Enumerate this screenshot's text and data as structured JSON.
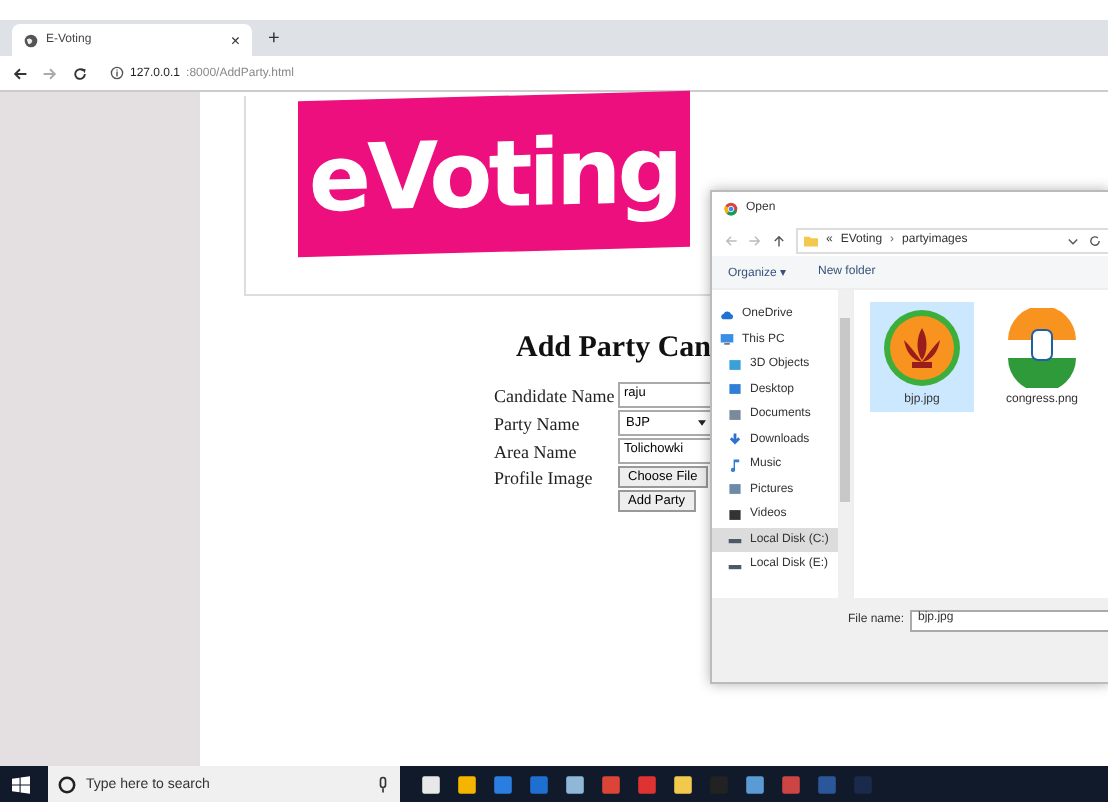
{
  "browser": {
    "tab": {
      "title": "E-Voting",
      "close": "×"
    },
    "new_tab": "+",
    "address": {
      "host": "127.0.0.1",
      "path": ":8000/AddParty.html"
    }
  },
  "page": {
    "logo": "eVoting",
    "heading": "Add Party Can",
    "fields": [
      {
        "label": "Candidate Name",
        "kind": "text",
        "value": "raju"
      },
      {
        "label": "Party Name",
        "kind": "select",
        "value": "BJP"
      },
      {
        "label": "Area Name",
        "kind": "text",
        "value": "Tolichowki"
      },
      {
        "label": "Profile Image",
        "kind": "file",
        "value": "Choose File"
      }
    ],
    "submit": "Add Party"
  },
  "dialog": {
    "title": "Open",
    "breadcrumb": [
      "EVoting",
      "partyimages"
    ],
    "breadcrumb_overflow": "«",
    "breadcrumb_separator": "›",
    "toolbar": [
      "Organize ▾",
      "New folder"
    ],
    "nav": [
      {
        "label": "OneDrive",
        "kind": "cloud",
        "selected": false
      },
      {
        "label": "This PC",
        "kind": "pc",
        "selected": false,
        "children": [
          {
            "label": "3D Objects",
            "kind": "cube",
            "selected": false
          },
          {
            "label": "Desktop",
            "kind": "desktop",
            "selected": false
          },
          {
            "label": "Documents",
            "kind": "doc",
            "selected": false
          },
          {
            "label": "Downloads",
            "kind": "download",
            "selected": false
          },
          {
            "label": "Music",
            "kind": "music",
            "selected": false
          },
          {
            "label": "Pictures",
            "kind": "picture",
            "selected": false
          },
          {
            "label": "Videos",
            "kind": "video",
            "selected": false
          },
          {
            "label": "Local Disk (C:)",
            "kind": "disk",
            "selected": true
          },
          {
            "label": "Local Disk (E:)",
            "kind": "disk",
            "selected": false
          }
        ]
      }
    ],
    "files": [
      {
        "name": "bjp.jpg",
        "kind": "lotus",
        "selected": true
      },
      {
        "name": "congress.png",
        "kind": "hand",
        "selected": false
      }
    ],
    "file_name": {
      "label": "File name:",
      "value": "bjp.jpg"
    }
  },
  "taskbar": {
    "search_placeholder": "Type here to search"
  }
}
